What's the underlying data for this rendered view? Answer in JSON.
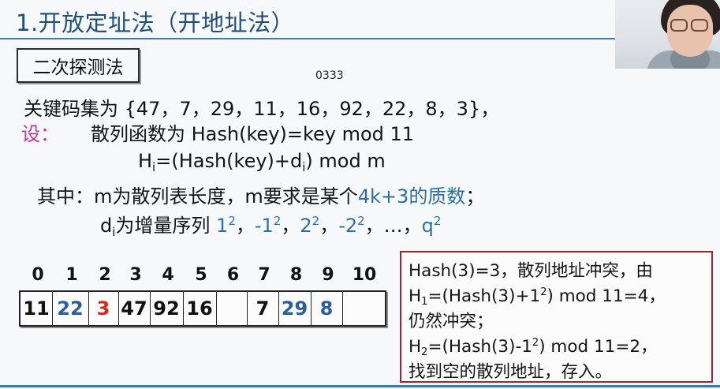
{
  "header": {
    "title": "1.开放定址法（开地址法）"
  },
  "method": {
    "label": "二次探测法"
  },
  "page_code": "0333",
  "keys_line": "关键码集为 {47，7，29，11，16，92，22，8，3}，",
  "set_label": "设：",
  "hash_def": "散列函数为  Hash(key)=key mod 11",
  "formula": {
    "H": "H",
    "i1": "i",
    "middle": "=(Hash(key)+d",
    "i2": "i",
    "end": ") mod m"
  },
  "where": {
    "prefix": "其中：m为散列表长度，m要求是某个",
    "highlight": "4k+3的质数",
    "suffix": "；"
  },
  "di": {
    "d": "d",
    "i": "i",
    "text": "为增量序列 ",
    "seq": [
      {
        "base": "1",
        "exp": "2",
        "sep": "，"
      },
      {
        "base": "-1",
        "exp": "2",
        "sep": "，"
      },
      {
        "base": "2",
        "exp": "2",
        "sep": "，"
      },
      {
        "base": "-2",
        "exp": "2",
        "sep": "，…，"
      },
      {
        "base": "q",
        "exp": "2",
        "sep": ""
      }
    ]
  },
  "table": {
    "indices": [
      "0",
      "1",
      "2",
      "3",
      "4",
      "5",
      "6",
      "7",
      "8",
      "9",
      "10"
    ],
    "cells": [
      "11",
      "22",
      "3",
      "47",
      "92",
      "16",
      "",
      "7",
      "29",
      "8",
      ""
    ],
    "cell_colors": [
      "black",
      "blue",
      "red",
      "black",
      "black",
      "black",
      "black",
      "black",
      "blue",
      "blue",
      "black"
    ]
  },
  "explain": {
    "l1": "Hash(3)=3，散列地址冲突，由",
    "l2_a": "H",
    "l2_sub": "1",
    "l2_b": "=(Hash(3)+1",
    "l2_sup": "2",
    "l2_c": ") mod 11=4，",
    "l3": "仍然冲突；",
    "l4_a": "H",
    "l4_sub": "2",
    "l4_b": "=(Hash(3)-1",
    "l4_sup": "2",
    "l4_c": ") mod 11=2，",
    "l5": "找到空的散列地址，存入。"
  },
  "colors": {
    "title": "#1f4e79",
    "accent_pink": "#c0399a",
    "blue": "#2e6ea6",
    "red": "#d5281c",
    "box_border": "#b0202a"
  }
}
